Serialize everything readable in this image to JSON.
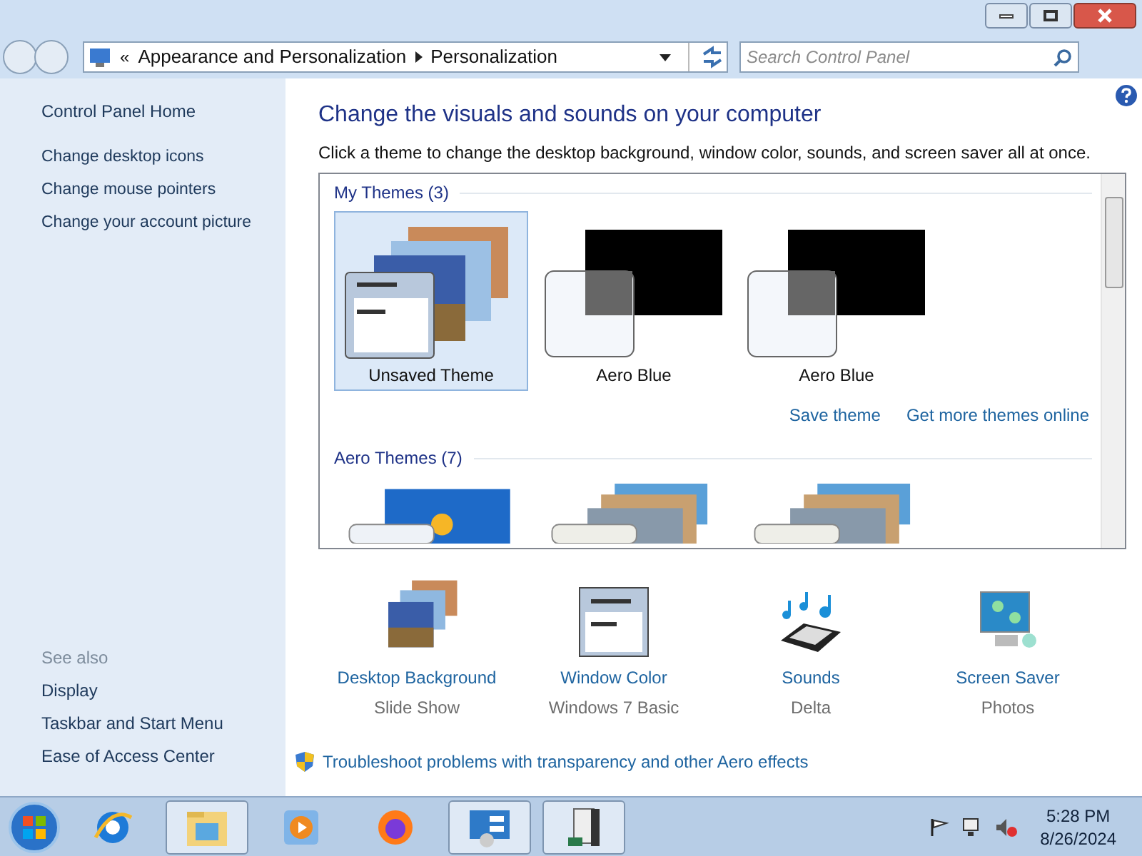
{
  "address_bar": {
    "overflow": "«",
    "crumbs": [
      "Appearance and Personalization",
      "Personalization"
    ]
  },
  "search": {
    "placeholder": "Search Control Panel"
  },
  "sidebar": {
    "home": "Control Panel Home",
    "links": [
      "Change desktop icons",
      "Change mouse pointers",
      "Change your account picture"
    ],
    "see_also_title": "See also",
    "see_also": [
      "Display",
      "Taskbar and Start Menu",
      "Ease of Access Center"
    ]
  },
  "heading": "Change the visuals and sounds on your computer",
  "description": "Click a theme to change the desktop background, window color, sounds, and screen saver all at once.",
  "theme_sections": [
    {
      "title": "My Themes (3)",
      "items": [
        {
          "label": "Unsaved Theme",
          "kind": "custom",
          "selected": true
        },
        {
          "label": "Aero Blue",
          "kind": "black",
          "selected": false
        },
        {
          "label": "Aero Blue",
          "kind": "black",
          "selected": false
        }
      ],
      "links": [
        "Save theme",
        "Get more themes online"
      ]
    },
    {
      "title": "Aero Themes (7)",
      "items": [
        {
          "kind": "windows",
          "selected": false
        },
        {
          "kind": "stack",
          "selected": false
        },
        {
          "kind": "stack",
          "selected": false
        }
      ]
    }
  ],
  "settings": [
    {
      "kind": "background",
      "label": "Desktop Background",
      "value": "Slide Show"
    },
    {
      "kind": "color",
      "label": "Window Color",
      "value": "Windows 7 Basic"
    },
    {
      "kind": "sounds",
      "label": "Sounds",
      "value": "Delta"
    },
    {
      "kind": "saver",
      "label": "Screen Saver",
      "value": "Photos"
    }
  ],
  "troubleshoot": "Troubleshoot problems with transparency and other Aero effects",
  "taskbar": {
    "apps": [
      {
        "kind": "ie",
        "running": false
      },
      {
        "kind": "explorer",
        "running": true
      },
      {
        "kind": "media",
        "running": false
      },
      {
        "kind": "firefox",
        "running": false
      },
      {
        "kind": "control",
        "running": true
      },
      {
        "kind": "server",
        "running": true
      }
    ],
    "time": "5:28 PM",
    "date": "8/26/2024"
  }
}
